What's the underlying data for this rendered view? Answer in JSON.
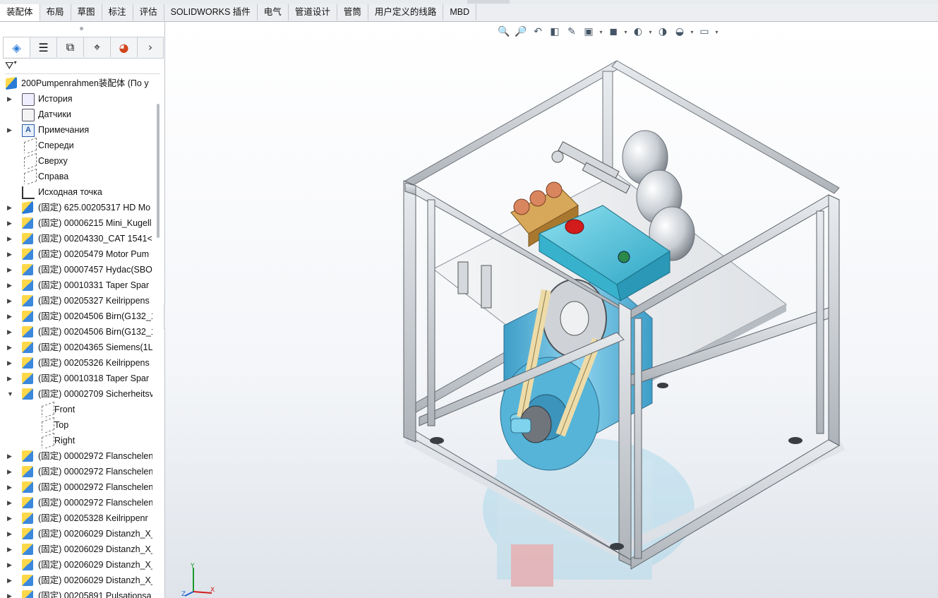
{
  "ribbon_tabs": [
    "装配体",
    "布局",
    "草图",
    "标注",
    "评估",
    "SOLIDWORKS 插件",
    "电气",
    "管道设计",
    "管筒",
    "用户定义的线路",
    "MBD"
  ],
  "active_tab_index": 0,
  "panel_tabs": [
    {
      "icon": "featuremanager-icon",
      "active": true
    },
    {
      "icon": "propertymanager-icon",
      "active": false
    },
    {
      "icon": "configurationmanager-icon",
      "active": false
    },
    {
      "icon": "dimxpert-icon",
      "active": false
    },
    {
      "icon": "display-manager-icon",
      "active": false
    }
  ],
  "filter_icon": "filter-icon",
  "tree": [
    {
      "level": 0,
      "expand": "",
      "icon": "asm",
      "label": "200Pumpenrahmen装配体 (По у"
    },
    {
      "level": 1,
      "expand": "▶",
      "icon": "hist",
      "label": "История"
    },
    {
      "level": 1,
      "expand": "",
      "icon": "sens",
      "label": "Датчики"
    },
    {
      "level": 1,
      "expand": "▶",
      "icon": "ann",
      "label": "Примечания"
    },
    {
      "level": 1,
      "expand": "",
      "icon": "plane",
      "label": "Спереди"
    },
    {
      "level": 1,
      "expand": "",
      "icon": "plane",
      "label": "Сверху"
    },
    {
      "level": 1,
      "expand": "",
      "icon": "plane",
      "label": "Справа"
    },
    {
      "level": 1,
      "expand": "",
      "icon": "origin",
      "label": "Исходная точка"
    },
    {
      "level": 1,
      "expand": "▶",
      "icon": "asm",
      "label": "(固定) 625.00205317 HD Mo"
    },
    {
      "level": 1,
      "expand": "▶",
      "icon": "part",
      "label": "(固定) 00006215 Mini_Kugell"
    },
    {
      "level": 1,
      "expand": "▶",
      "icon": "part",
      "label": "(固定) 00204330_CAT 1541<"
    },
    {
      "level": 1,
      "expand": "▶",
      "icon": "part",
      "label": "(固定) 00205479 Motor Pum"
    },
    {
      "level": 1,
      "expand": "▶",
      "icon": "part",
      "label": "(固定) 00007457 Hydac(SBO"
    },
    {
      "level": 1,
      "expand": "▶",
      "icon": "part",
      "label": "(固定) 00010331 Taper Spar"
    },
    {
      "level": 1,
      "expand": "▶",
      "icon": "part",
      "label": "(固定) 00205327 Keilrippens"
    },
    {
      "level": 1,
      "expand": "▶",
      "icon": "part",
      "label": "(固定) 00204506 Birn(G132_1"
    },
    {
      "level": 1,
      "expand": "▶",
      "icon": "part",
      "label": "(固定) 00204506 Birn(G132_1"
    },
    {
      "level": 1,
      "expand": "▶",
      "icon": "part",
      "label": "(固定) 00204365 Siemens(1L"
    },
    {
      "level": 1,
      "expand": "▶",
      "icon": "part",
      "label": "(固定) 00205326 Keilrippens"
    },
    {
      "level": 1,
      "expand": "▶",
      "icon": "part",
      "label": "(固定) 00010318 Taper Spar"
    },
    {
      "level": 1,
      "expand": "▼",
      "icon": "part",
      "label": "(固定) 00002709 Sicherheitsv"
    },
    {
      "level": 2,
      "expand": "",
      "icon": "plane",
      "label": "Front"
    },
    {
      "level": 2,
      "expand": "",
      "icon": "plane",
      "label": "Top"
    },
    {
      "level": 2,
      "expand": "",
      "icon": "plane",
      "label": "Right"
    },
    {
      "level": 1,
      "expand": "▶",
      "icon": "part",
      "label": "(固定) 00002972 Flanschelen"
    },
    {
      "level": 1,
      "expand": "▶",
      "icon": "part",
      "label": "(固定) 00002972 Flanschelen"
    },
    {
      "level": 1,
      "expand": "▶",
      "icon": "part",
      "label": "(固定) 00002972 Flanschelen"
    },
    {
      "level": 1,
      "expand": "▶",
      "icon": "part",
      "label": "(固定) 00002972 Flanschelen"
    },
    {
      "level": 1,
      "expand": "▶",
      "icon": "part",
      "label": "(固定) 00205328 Keilrippenr"
    },
    {
      "level": 1,
      "expand": "▶",
      "icon": "part",
      "label": "(固定) 00206029 Distanzh_X_"
    },
    {
      "level": 1,
      "expand": "▶",
      "icon": "part",
      "label": "(固定) 00206029 Distanzh_X_"
    },
    {
      "level": 1,
      "expand": "▶",
      "icon": "part",
      "label": "(固定) 00206029 Distanzh_X_"
    },
    {
      "level": 1,
      "expand": "▶",
      "icon": "part",
      "label": "(固定) 00206029 Distanzh_X_"
    },
    {
      "level": 1,
      "expand": "▶",
      "icon": "part",
      "label": "(固定) 00205891 Pulsationsa"
    }
  ],
  "view_toolbar": [
    "zoom-to-fit-icon",
    "zoom-to-area-icon",
    "previous-view-icon",
    "section-view-icon",
    "dynamic-annotation-icon",
    "view-orientation-icon",
    "display-style-icon",
    "hide-show-icon",
    "edit-appearance-icon",
    "apply-scene-icon",
    "view-settings-icon"
  ],
  "triad_axes": [
    "Y",
    "X",
    "Z"
  ],
  "colors": {
    "frame": "#c9cdd2",
    "pump_body": "#4cc4dc",
    "motor": "#5db3d6",
    "brass": "#c99a4a",
    "red_cap": "#d21b1b",
    "accumulator": "#d9dde2"
  }
}
